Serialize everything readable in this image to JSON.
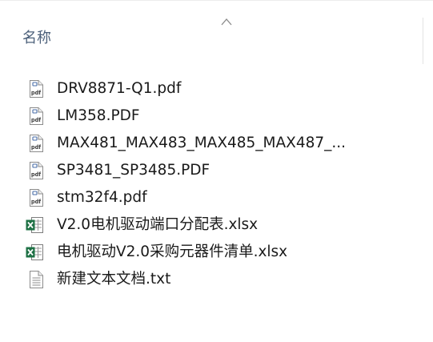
{
  "header": {
    "column_name_label": "名称",
    "sort_indicator": "ascending"
  },
  "files": [
    {
      "name": "DRV8871-Q1.pdf",
      "type": "pdf",
      "icon": "pdf-file-icon"
    },
    {
      "name": "LM358.PDF",
      "type": "pdf",
      "icon": "pdf-file-icon"
    },
    {
      "name": "MAX481_MAX483_MAX485_MAX487_...",
      "type": "pdf",
      "icon": "pdf-file-icon"
    },
    {
      "name": "SP3481_SP3485.PDF",
      "type": "pdf",
      "icon": "pdf-file-icon"
    },
    {
      "name": "stm32f4.pdf",
      "type": "pdf",
      "icon": "pdf-file-icon"
    },
    {
      "name": "V2.0电机驱动端口分配表.xlsx",
      "type": "xlsx",
      "icon": "excel-file-icon"
    },
    {
      "name": "电机驱动V2.0采购元器件清单.xlsx",
      "type": "xlsx",
      "icon": "excel-file-icon"
    },
    {
      "name": "新建文本文档.txt",
      "type": "txt",
      "icon": "text-file-icon"
    }
  ],
  "colors": {
    "column_label": "#4c607a",
    "pdf_badge": "#c8371d",
    "excel_green": "#1e7145",
    "text": "#1a1a1a"
  }
}
